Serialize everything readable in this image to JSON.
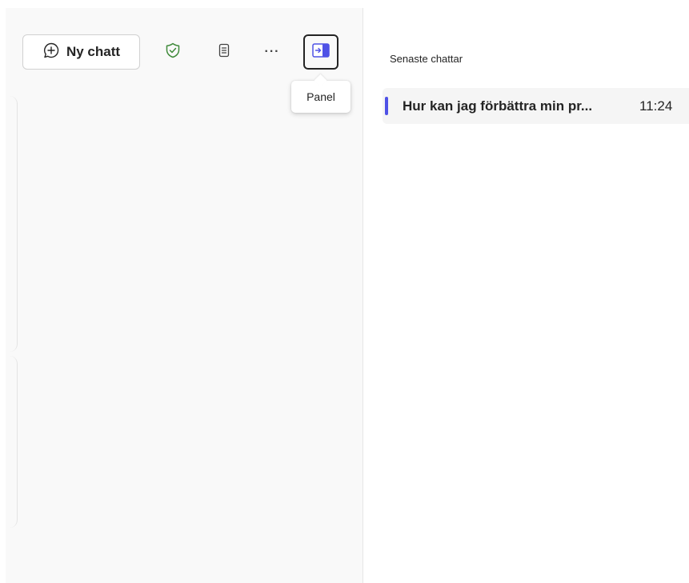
{
  "toolbar": {
    "new_chat_label": "Ny chatt",
    "more_label": "···"
  },
  "tooltip": {
    "text": "Panel"
  },
  "recent": {
    "title": "Senaste chattar",
    "items": [
      {
        "title": "Hur kan jag förbättra min pr...",
        "time": "11:24",
        "selected": true
      }
    ]
  },
  "colors": {
    "accent": "#4f52e6",
    "shield": "#3f8a3a",
    "pane_bg": "#f9f9f9"
  },
  "icons": [
    "add-chat-icon",
    "shield-check-icon",
    "notes-icon",
    "more-icon",
    "panel-icon"
  ]
}
